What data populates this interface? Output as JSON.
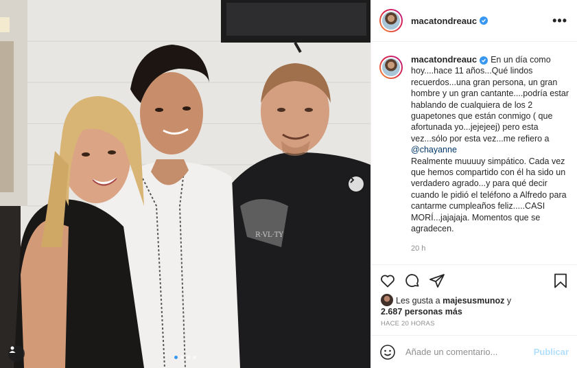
{
  "post": {
    "username": "macatondreauc",
    "more_icon": "•••",
    "caption_lines": [
      "En un día como hoy....hace 11 años...Qué lindos recuerdos...una gran persona, un gran hombre y un gran cantante....podría estar hablando de cualquiera de los 2 guapetones que están conmigo ( que afortunada yo...jejejeej) pero esta vez...sólo por esta vez...me refiero a ",
      "Realmente muuuuy simpático. Cada vez que hemos compartido con él ha sido un verdadero agrado...y para qué decir cuando le pidió el teléfono a Alfredo para cantarme cumpleaños feliz.....CASI MORÍ...jajajaja. Momentos que se agradecen."
    ],
    "mention": "@chayanne",
    "caption_time": "20 h",
    "likes_prefix": "Les gusta a ",
    "likes_user": "majesusmunoz",
    "likes_and": " y",
    "likes_count": "2.687 personas más",
    "posted_time": "HACE 20 HORAS",
    "comment_placeholder": "Añade un comentario...",
    "publish_label": "Publicar",
    "carousel": {
      "total": 4,
      "active": 1
    }
  },
  "icons": {
    "like": "heart-icon",
    "comment": "comment-icon",
    "share": "share-icon",
    "save": "bookmark-icon",
    "emoji": "emoji-icon",
    "next": "chevron-right-icon",
    "tag": "user-tag-icon"
  },
  "colors": {
    "verified": "#3897f0",
    "publish_disabled": "#b2dffc",
    "link": "#00376b",
    "muted": "#8e8e8e"
  }
}
